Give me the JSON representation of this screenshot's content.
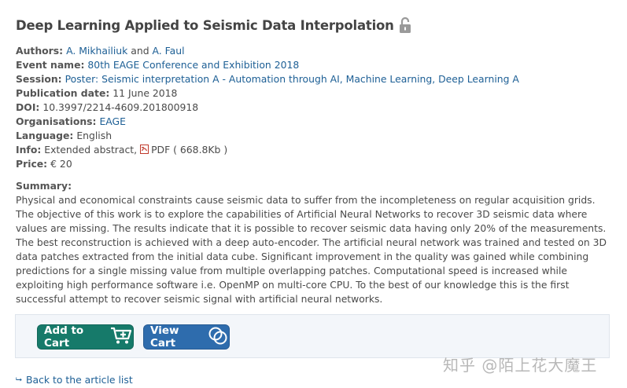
{
  "article": {
    "title": "Deep Learning Applied to Seismic Data Interpolation",
    "lock_icon": "lock-icon"
  },
  "meta": {
    "authors_label": "Authors:",
    "author1": "A. Mikhailiuk",
    "authors_and": "and",
    "author2": "A. Faul",
    "event_label": "Event name:",
    "event": "80th EAGE Conference and Exhibition 2018",
    "session_label": "Session:",
    "session": "Poster: Seismic interpretation A - Automation through AI, Machine Learning, Deep Learning A",
    "pubdate_label": "Publication date:",
    "pubdate": "11 June 2018",
    "doi_label": "DOI:",
    "doi": "10.3997/2214-4609.201800918",
    "org_label": "Organisations:",
    "org": "EAGE",
    "language_label": "Language:",
    "language": "English",
    "info_label": "Info:",
    "info_text": "Extended abstract,",
    "pdf_text": "PDF ( 668.8Kb )",
    "price_label": "Price:",
    "price": "€ 20"
  },
  "summary": {
    "label": "Summary:",
    "text": "Physical and economical constraints cause seismic data to suffer from the incompleteness on regular acquisition grids. The objective of this work is to explore the capabilities of Artificial Neural Networks to recover 3D seismic data where values are missing. The results indicate that it is possible to recover seismic data having only 20% of the measurements. The best reconstruction is achieved with a deep auto-encoder. The artificial neural network was trained and tested on 3D data patches extracted from the initial data cube. Significant improvement in the quality was gained while combining predictions for a single missing value from multiple overlapping patches. Computational speed is increased while exploiting high performance software i.e. OpenMP on multi-core CPU. To the best of our knowledge this is the first successful attempt to recover seismic signal with artificial neural networks."
  },
  "cart": {
    "add_label": "Add to Cart",
    "view_label": "View Cart",
    "add_color": "#167a6a",
    "view_color": "#2e6cad"
  },
  "nav": {
    "back_label": "Back to the article list"
  },
  "watermark": {
    "text": "知乎 @陌上花大魔王"
  },
  "colors": {
    "link": "#1d5f95",
    "text": "#4a4a4a"
  }
}
